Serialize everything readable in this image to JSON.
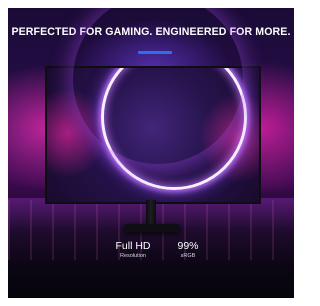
{
  "headline": "PERFECTED FOR GAMING. ENGINEERED FOR MORE.",
  "colors": {
    "accent": "#2f6df0",
    "glow": "#d62aa8",
    "ring": "#f6f0ff"
  },
  "specs": [
    {
      "value": "Full HD",
      "label": "Resolution"
    },
    {
      "value": "99%",
      "label": "sRGB"
    }
  ]
}
